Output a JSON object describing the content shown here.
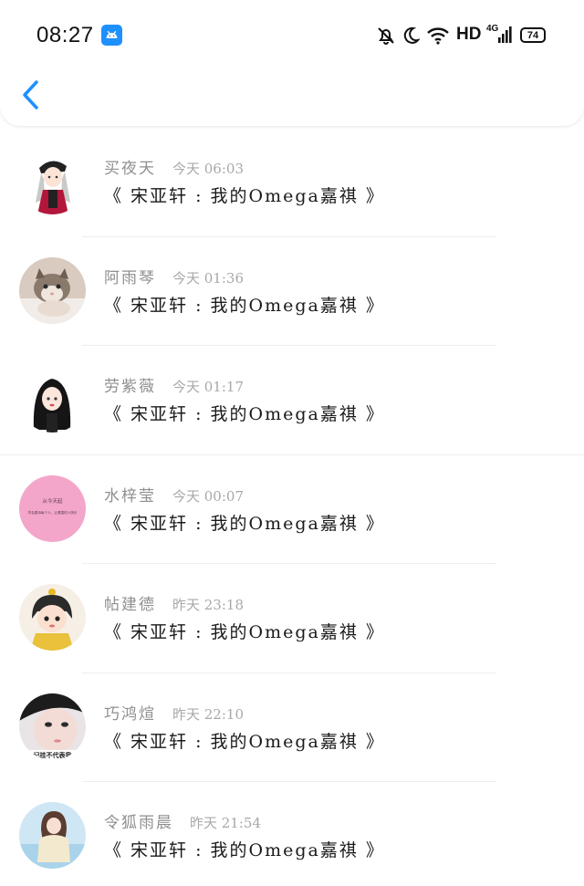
{
  "status_bar": {
    "time": "08:27",
    "network": "HD",
    "signal_label": "4G",
    "battery": "74"
  },
  "header": {
    "back_icon": "chevron-left-icon"
  },
  "messages": [
    {
      "name": "买夜天",
      "time": "今天 06:03",
      "text": "《 宋亚轩 : 我的Omega嘉祺 》",
      "avatar": "girl-cap-illustration"
    },
    {
      "name": "阿雨琴",
      "time": "今天 01:36",
      "text": "《 宋亚轩 : 我的Omega嘉祺 》",
      "avatar": "kitten-photo"
    },
    {
      "name": "劳紫薇",
      "time": "今天 01:17",
      "text": "《 宋亚轩 : 我的Omega嘉祺 》",
      "avatar": "dark-hair-girl-illustration"
    },
    {
      "name": "水梓莹",
      "time": "今天 00:07",
      "text": "《 宋亚轩 : 我的Omega嘉祺 》",
      "avatar": "pink-text-card",
      "avatar_text": [
        "从今天起",
        "学会善待每个人，让周围的人快乐"
      ]
    },
    {
      "name": "帖建德",
      "time": "昨天 23:18",
      "text": "《 宋亚轩 : 我的Omega嘉祺 》",
      "avatar": "chibi-character"
    },
    {
      "name": "巧鸿煊",
      "time": "昨天 22:10",
      "text": "《 宋亚轩 : 我的Omega嘉祺 》",
      "avatar": "girl-closeup-photo",
      "avatar_text": [
        "记挂不代表我"
      ]
    },
    {
      "name": "令狐雨晨",
      "time": "昨天 21:54",
      "text": "《 宋亚轩 : 我的Omega嘉祺 》",
      "avatar": "girl-beach-photo"
    }
  ],
  "colors": {
    "accent": "#1e90ff",
    "name_gray": "#8f8f8f",
    "time_gray": "#a8a8a8"
  }
}
